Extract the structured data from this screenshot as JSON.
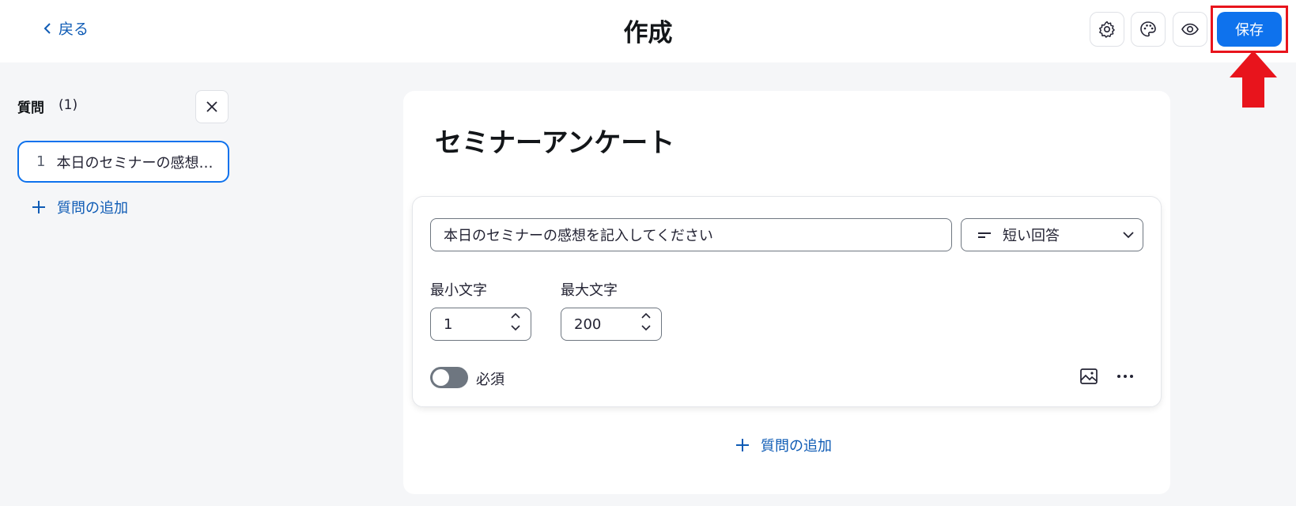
{
  "header": {
    "back_label": "戻る",
    "title": "作成",
    "save_label": "保存"
  },
  "sidebar": {
    "title": "質問",
    "count": "(1)",
    "questions": [
      {
        "number": "1",
        "text": "本日のセミナーの感想を記入してください"
      }
    ],
    "add_label": "質問の追加"
  },
  "main": {
    "survey_title": "セミナーアンケート",
    "question": {
      "text": "本日のセミナーの感想を記入してください",
      "type_label": "短い回答",
      "min_label": "最小文字",
      "min_value": "1",
      "max_label": "最大文字",
      "max_value": "200",
      "required_label": "必須",
      "required_on": false
    },
    "add_label": "質問の追加"
  },
  "colors": {
    "accent": "#0e72ed",
    "link": "#0e5bb5",
    "highlight": "#e8141c"
  }
}
